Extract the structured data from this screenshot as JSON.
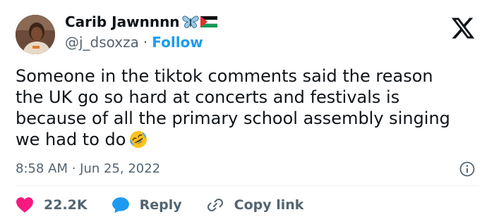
{
  "author": {
    "display_name": "Carib Jawnnnn",
    "name_emojis": [
      "butterfly-icon",
      "palestine-flag-icon"
    ],
    "handle": "@j_dsoxza",
    "separator": "·",
    "follow_label": "Follow"
  },
  "brand": {
    "logo": "x-logo-icon"
  },
  "tweet": {
    "lines": [
      "Someone in the tiktok comments said the reason",
      "the UK go so hard at concerts and festivals is",
      "because of all the primary school assembly singing",
      "we had to do"
    ],
    "trailing_emoji": "rolling-on-floor-laughing-icon"
  },
  "meta": {
    "timestamp": "8:58 AM · Jun 25, 2022"
  },
  "actions": {
    "likes_count": "22.2K",
    "reply_label": "Reply",
    "copy_link_label": "Copy link"
  },
  "colors": {
    "accent": "#1d9bf0",
    "like_red": "#f91880",
    "text_primary": "#0f1419",
    "text_secondary": "#536471"
  }
}
